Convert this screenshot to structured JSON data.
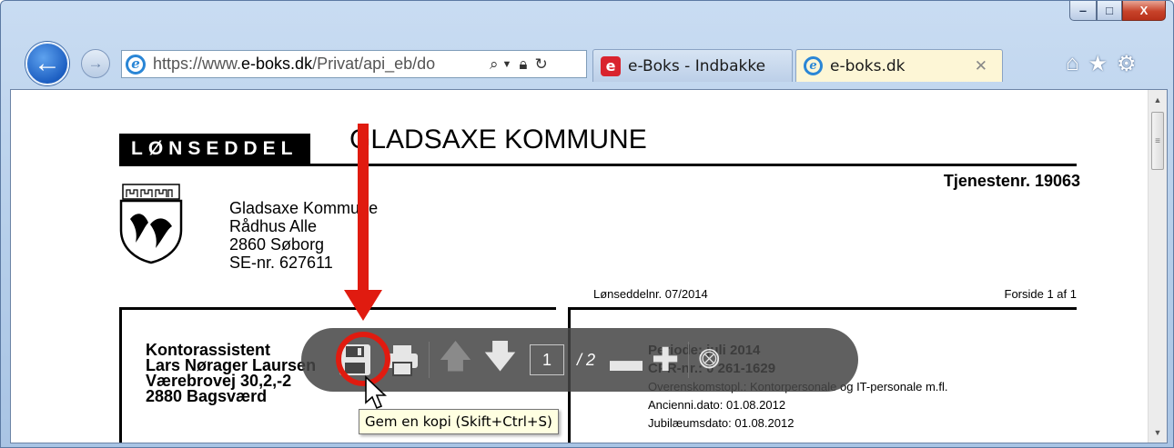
{
  "browser": {
    "address_url_prefix": "https://www.",
    "address_url_domain": "e-boks.dk",
    "address_url_path": "/Privat/api_eb/do",
    "tabs": [
      {
        "label": "e-Boks - Indbakke",
        "active": false
      },
      {
        "label": "e-boks.dk",
        "active": true
      }
    ],
    "caption_buttons": {
      "minimize": "‒",
      "maximize": "□",
      "close": "X"
    },
    "icons": [
      "back-arrow-icon",
      "forward-arrow-icon",
      "ie-logo-icon",
      "search-icon",
      "lock-icon",
      "refresh-icon",
      "home-icon",
      "favorites-star-icon",
      "settings-gear-icon"
    ]
  },
  "document": {
    "label": "LØNSEDDEL",
    "municipality": "GLADSAXE KOMMUNE",
    "tjenestenr": "Tjenestenr. 19063",
    "address_lines": [
      "Gladsaxe Kommune",
      "Rådhus Alle",
      "2860 Søborg",
      "SE-nr. 627611"
    ],
    "slip_number": "Lønseddelnr. 07/2014",
    "page_info": "Forside 1 af 1",
    "employee": [
      "Kontorassistent",
      "Lars Nørager Laursen",
      "Værebrovej 30,2,-2",
      "2880  Bagsværd"
    ],
    "period_lines": [
      "Periode: juli 2014",
      "CPR-nr.: 0   261-1629",
      "Overenskomstopl.: Kontorpersonale og IT-personale m.fl.",
      "Ancienni.dato: 01.08.2012",
      "Jubilæumsdato: 01.08.2012"
    ]
  },
  "pdf_toolbar": {
    "current_page": "1",
    "total_pages": "/ 2",
    "tooltip": "Gem en kopi (Skift+Ctrl+S)",
    "icons": [
      "save-icon",
      "print-icon",
      "previous-page-icon",
      "next-page-icon",
      "zoom-out-icon",
      "zoom-in-icon",
      "acrobat-icon"
    ]
  },
  "colors": {
    "annotation": "#e01b10",
    "toolbar": "#464646",
    "tooltip_bg": "#ffffe1"
  }
}
